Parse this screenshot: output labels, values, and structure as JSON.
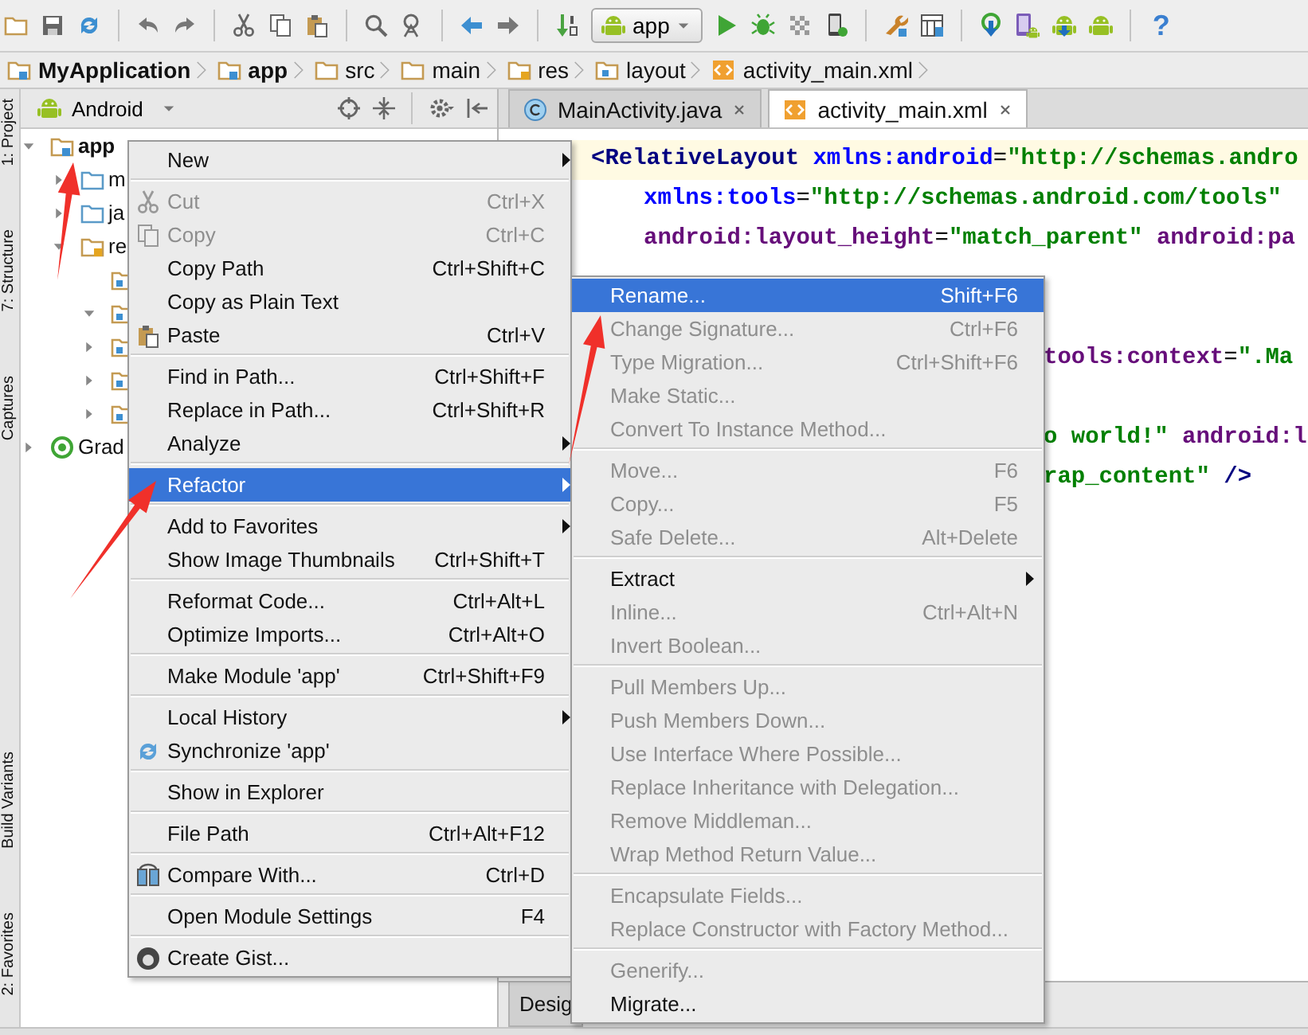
{
  "toolbar": {
    "run_config": "app",
    "help": "?"
  },
  "breadcrumb": [
    {
      "label": "MyApplication",
      "kind": "project"
    },
    {
      "label": "app",
      "kind": "module"
    },
    {
      "label": "src",
      "kind": "folder"
    },
    {
      "label": "main",
      "kind": "folder"
    },
    {
      "label": "res",
      "kind": "res"
    },
    {
      "label": "layout",
      "kind": "layout"
    },
    {
      "label": "activity_main.xml",
      "kind": "xml"
    }
  ],
  "tool_strip": {
    "top": [
      "1: Project",
      "7: Structure",
      "Captures"
    ],
    "bottom": [
      "Build Variants",
      "2: Favorites"
    ]
  },
  "project_panel": {
    "view": "Android",
    "tree": [
      {
        "label": "app",
        "kind": "module",
        "expanded": true,
        "children": [
          {
            "label": "m",
            "kind": "folder",
            "expanded": false
          },
          {
            "label": "ja",
            "kind": "folder",
            "expanded": false
          },
          {
            "label": "re",
            "kind": "res",
            "expanded": true,
            "children": [
              {
                "kind": "subfolder"
              },
              {
                "kind": "subfolder",
                "expanded": true
              },
              {
                "kind": "subfolder",
                "expanded": false
              },
              {
                "kind": "subfolder",
                "expanded": false
              },
              {
                "kind": "subfolder",
                "expanded": false
              }
            ]
          }
        ]
      },
      {
        "label": "Grad",
        "kind": "gradle",
        "expanded": false
      }
    ]
  },
  "editor": {
    "tabs": [
      {
        "label": "MainActivity.java",
        "kind": "java",
        "selected": false
      },
      {
        "label": "activity_main.xml",
        "kind": "xml",
        "selected": true
      }
    ],
    "lines": [
      {
        "kind": "current",
        "tokens": [
          {
            "kind": "tag",
            "text": "<RelativeLayout"
          },
          {
            "kind": "attr",
            "text": " xmlns:android"
          },
          {
            "kind": "plain",
            "text": "="
          },
          {
            "kind": "value",
            "text": "\"http://schemas.andro"
          }
        ]
      },
      {
        "kind": "indented",
        "tokens": [
          {
            "kind": "attr",
            "text": "xmlns:tools"
          },
          {
            "kind": "plain",
            "text": "="
          },
          {
            "kind": "value",
            "text": "\"http://schemas.android.com/tools\""
          }
        ]
      },
      {
        "kind": "indented",
        "tokens": [
          {
            "kind": "ns",
            "text": "android:layout_height"
          },
          {
            "kind": "plain",
            "text": "="
          },
          {
            "kind": "value",
            "text": "\"match_parent\""
          },
          {
            "kind": "ns",
            "text": " android:pa"
          }
        ]
      },
      {
        "kind": "covered"
      },
      {
        "kind": "covered"
      },
      {
        "kind": "fragment",
        "tokens": [
          {
            "kind": "ns",
            "text": "tools:context"
          },
          {
            "kind": "plain",
            "text": "="
          },
          {
            "kind": "value",
            "text": "\".Ma"
          }
        ]
      },
      {
        "kind": "covered"
      },
      {
        "kind": "fragment",
        "tokens": [
          {
            "kind": "value",
            "text": "o world!\""
          },
          {
            "kind": "ns",
            "text": " android:l"
          }
        ]
      },
      {
        "kind": "fragment",
        "tokens": [
          {
            "kind": "value",
            "text": "rap_content\""
          },
          {
            "kind": "tag",
            "text": " />"
          }
        ]
      }
    ],
    "bottom_tab": "Desig"
  },
  "context_menu": {
    "items": [
      {
        "kind": "item",
        "label": "New",
        "submenu": true,
        "disabled": false,
        "selected": false
      },
      {
        "kind": "separator"
      },
      {
        "kind": "cut",
        "label": "Cut",
        "shortcut": "Ctrl+X",
        "submenu": false,
        "disabled": true,
        "selected": false
      },
      {
        "kind": "copy",
        "label": "Copy",
        "shortcut": "Ctrl+C",
        "submenu": false,
        "disabled": true,
        "selected": false
      },
      {
        "kind": "item",
        "label": "Copy Path",
        "shortcut": "Ctrl+Shift+C",
        "submenu": false,
        "disabled": false,
        "selected": false
      },
      {
        "kind": "item",
        "label": "Copy as Plain Text",
        "submenu": false,
        "disabled": false,
        "selected": false
      },
      {
        "kind": "paste",
        "label": "Paste",
        "shortcut": "Ctrl+V",
        "submenu": false,
        "disabled": false,
        "selected": false
      },
      {
        "kind": "separator"
      },
      {
        "kind": "item",
        "label": "Find in Path...",
        "shortcut": "Ctrl+Shift+F",
        "submenu": false,
        "disabled": false,
        "selected": false
      },
      {
        "kind": "item",
        "label": "Replace in Path...",
        "shortcut": "Ctrl+Shift+R",
        "submenu": false,
        "disabled": false,
        "selected": false
      },
      {
        "kind": "item",
        "label": "Analyze",
        "submenu": true,
        "disabled": false,
        "selected": false
      },
      {
        "kind": "separator"
      },
      {
        "kind": "item",
        "label": "Refactor",
        "submenu": true,
        "disabled": false,
        "selected": true
      },
      {
        "kind": "separator"
      },
      {
        "kind": "item",
        "label": "Add to Favorites",
        "submenu": true,
        "disabled": false,
        "selected": false
      },
      {
        "kind": "item",
        "label": "Show Image Thumbnails",
        "shortcut": "Ctrl+Shift+T",
        "submenu": false,
        "disabled": false,
        "selected": false
      },
      {
        "kind": "separator"
      },
      {
        "kind": "item",
        "label": "Reformat Code...",
        "shortcut": "Ctrl+Alt+L",
        "submenu": false,
        "disabled": false,
        "selected": false
      },
      {
        "kind": "item",
        "label": "Optimize Imports...",
        "shortcut": "Ctrl+Alt+O",
        "submenu": false,
        "disabled": false,
        "selected": false
      },
      {
        "kind": "separator"
      },
      {
        "kind": "item",
        "label": "Make Module 'app'",
        "shortcut": "Ctrl+Shift+F9",
        "submenu": false,
        "disabled": false,
        "selected": false
      },
      {
        "kind": "separator"
      },
      {
        "kind": "item",
        "label": "Local History",
        "submenu": true,
        "disabled": false,
        "selected": false
      },
      {
        "kind": "sync",
        "label": "Synchronize 'app'",
        "submenu": false,
        "disabled": false,
        "selected": false
      },
      {
        "kind": "separator"
      },
      {
        "kind": "item",
        "label": "Show in Explorer",
        "submenu": false,
        "disabled": false,
        "selected": false
      },
      {
        "kind": "separator"
      },
      {
        "kind": "item",
        "label": "File Path",
        "shortcut": "Ctrl+Alt+F12",
        "submenu": false,
        "disabled": false,
        "selected": false
      },
      {
        "kind": "separator"
      },
      {
        "kind": "compare",
        "label": "Compare With...",
        "shortcut": "Ctrl+D",
        "submenu": false,
        "disabled": false,
        "selected": false
      },
      {
        "kind": "separator"
      },
      {
        "kind": "item",
        "label": "Open Module Settings",
        "shortcut": "F4",
        "submenu": false,
        "disabled": false,
        "selected": false
      },
      {
        "kind": "separator"
      },
      {
        "kind": "gist",
        "label": "Create Gist...",
        "submenu": false,
        "disabled": false,
        "selected": false
      }
    ]
  },
  "refactor_submenu": {
    "items": [
      {
        "kind": "item",
        "label": "Rename...",
        "shortcut": "Shift+F6",
        "submenu": false,
        "disabled": false,
        "selected": true
      },
      {
        "kind": "item",
        "label": "Change Signature...",
        "shortcut": "Ctrl+F6",
        "submenu": false,
        "disabled": true,
        "selected": false
      },
      {
        "kind": "item",
        "label": "Type Migration...",
        "shortcut": "Ctrl+Shift+F6",
        "submenu": false,
        "disabled": true,
        "selected": false
      },
      {
        "kind": "item",
        "label": "Make Static...",
        "submenu": false,
        "disabled": true,
        "selected": false
      },
      {
        "kind": "item",
        "label": "Convert To Instance Method...",
        "submenu": false,
        "disabled": true,
        "selected": false
      },
      {
        "kind": "separator"
      },
      {
        "kind": "item",
        "label": "Move...",
        "shortcut": "F6",
        "submenu": false,
        "disabled": true,
        "selected": false
      },
      {
        "kind": "item",
        "label": "Copy...",
        "shortcut": "F5",
        "submenu": false,
        "disabled": true,
        "selected": false
      },
      {
        "kind": "item",
        "label": "Safe Delete...",
        "shortcut": "Alt+Delete",
        "submenu": false,
        "disabled": true,
        "selected": false
      },
      {
        "kind": "separator"
      },
      {
        "kind": "item",
        "label": "Extract",
        "submenu": true,
        "disabled": false,
        "selected": false
      },
      {
        "kind": "item",
        "label": "Inline...",
        "shortcut": "Ctrl+Alt+N",
        "submenu": false,
        "disabled": true,
        "selected": false
      },
      {
        "kind": "item",
        "label": "Invert Boolean...",
        "submenu": false,
        "disabled": true,
        "selected": false
      },
      {
        "kind": "separator"
      },
      {
        "kind": "item",
        "label": "Pull Members Up...",
        "submenu": false,
        "disabled": true,
        "selected": false
      },
      {
        "kind": "item",
        "label": "Push Members Down...",
        "submenu": false,
        "disabled": true,
        "selected": false
      },
      {
        "kind": "item",
        "label": "Use Interface Where Possible...",
        "submenu": false,
        "disabled": true,
        "selected": false
      },
      {
        "kind": "item",
        "label": "Replace Inheritance with Delegation...",
        "submenu": false,
        "disabled": true,
        "selected": false
      },
      {
        "kind": "item",
        "label": "Remove Middleman...",
        "submenu": false,
        "disabled": true,
        "selected": false
      },
      {
        "kind": "item",
        "label": "Wrap Method Return Value...",
        "submenu": false,
        "disabled": true,
        "selected": false
      },
      {
        "kind": "separator"
      },
      {
        "kind": "item",
        "label": "Encapsulate Fields...",
        "submenu": false,
        "disabled": true,
        "selected": false
      },
      {
        "kind": "item",
        "label": "Replace Constructor with Factory Method...",
        "submenu": false,
        "disabled": true,
        "selected": false
      },
      {
        "kind": "separator"
      },
      {
        "kind": "item",
        "label": "Generify...",
        "submenu": false,
        "disabled": true,
        "selected": false
      },
      {
        "kind": "item",
        "label": "Migrate...",
        "submenu": false,
        "disabled": false,
        "selected": false
      }
    ]
  }
}
